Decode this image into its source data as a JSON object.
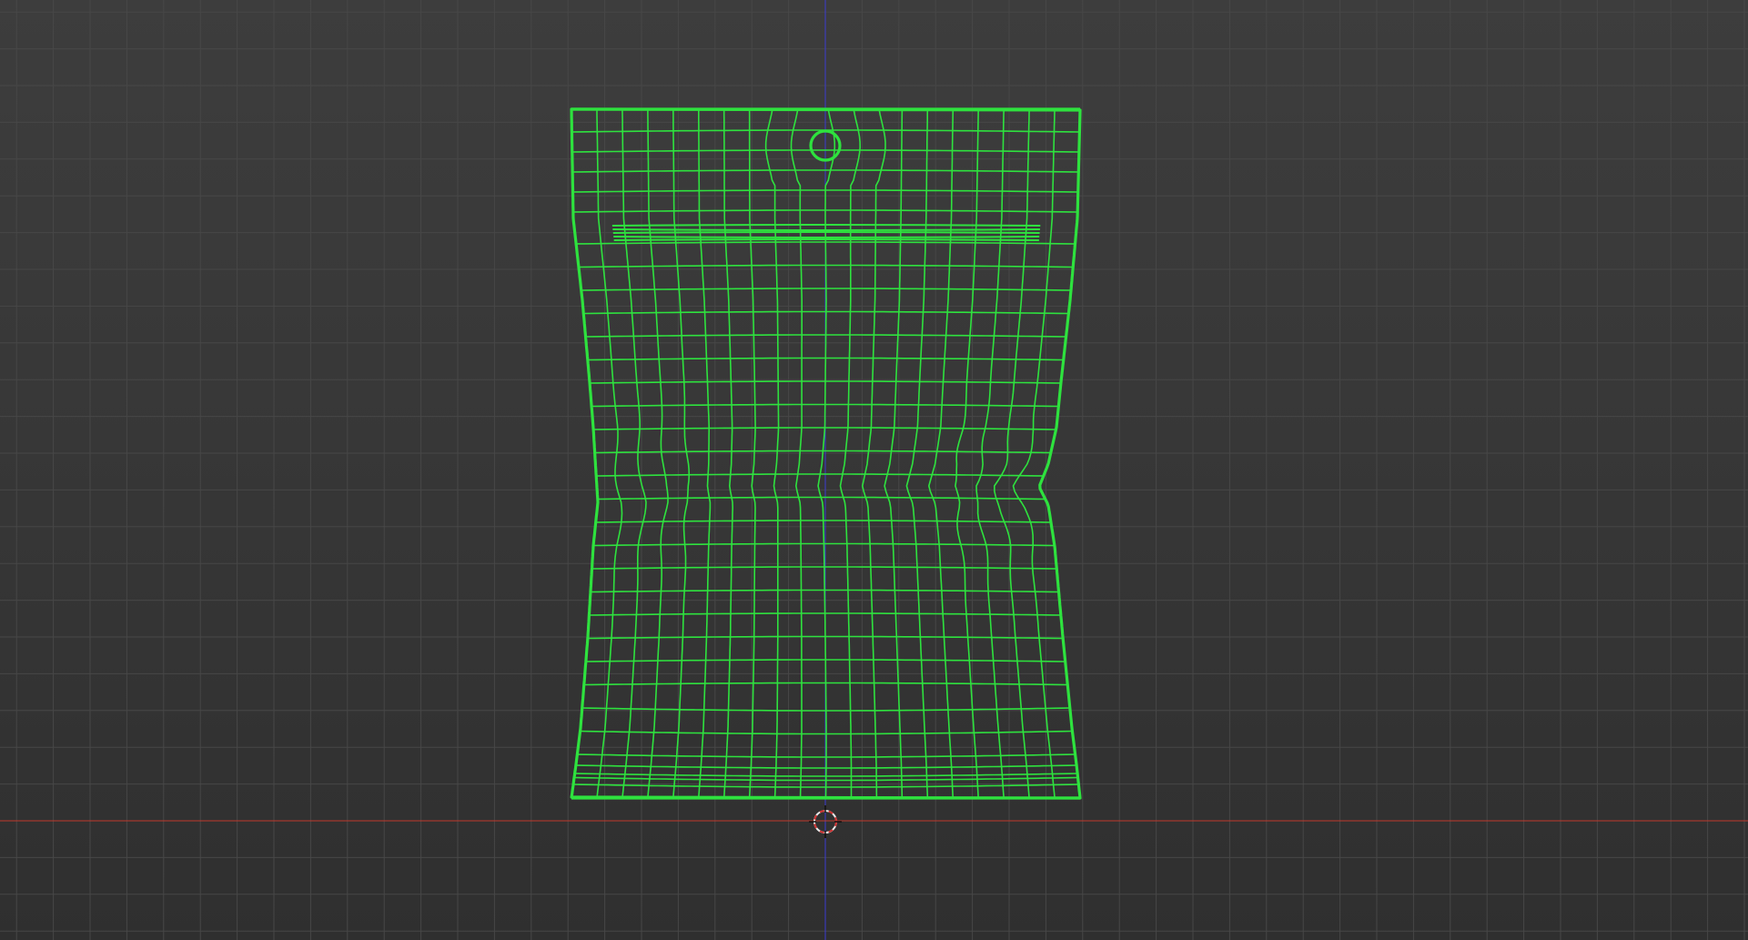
{
  "viewport": {
    "view": "front-orthographic",
    "shading": "wireframe",
    "background_color": "#393939",
    "grid_color": "#474747",
    "axis_x_color": "#c0392b",
    "axis_z_color": "#3b3bd0",
    "wire_color": "#2ee23e",
    "cursor_color": "#e8e8e8",
    "cursor_accent": "#d03030"
  },
  "object": {
    "selected": true
  }
}
